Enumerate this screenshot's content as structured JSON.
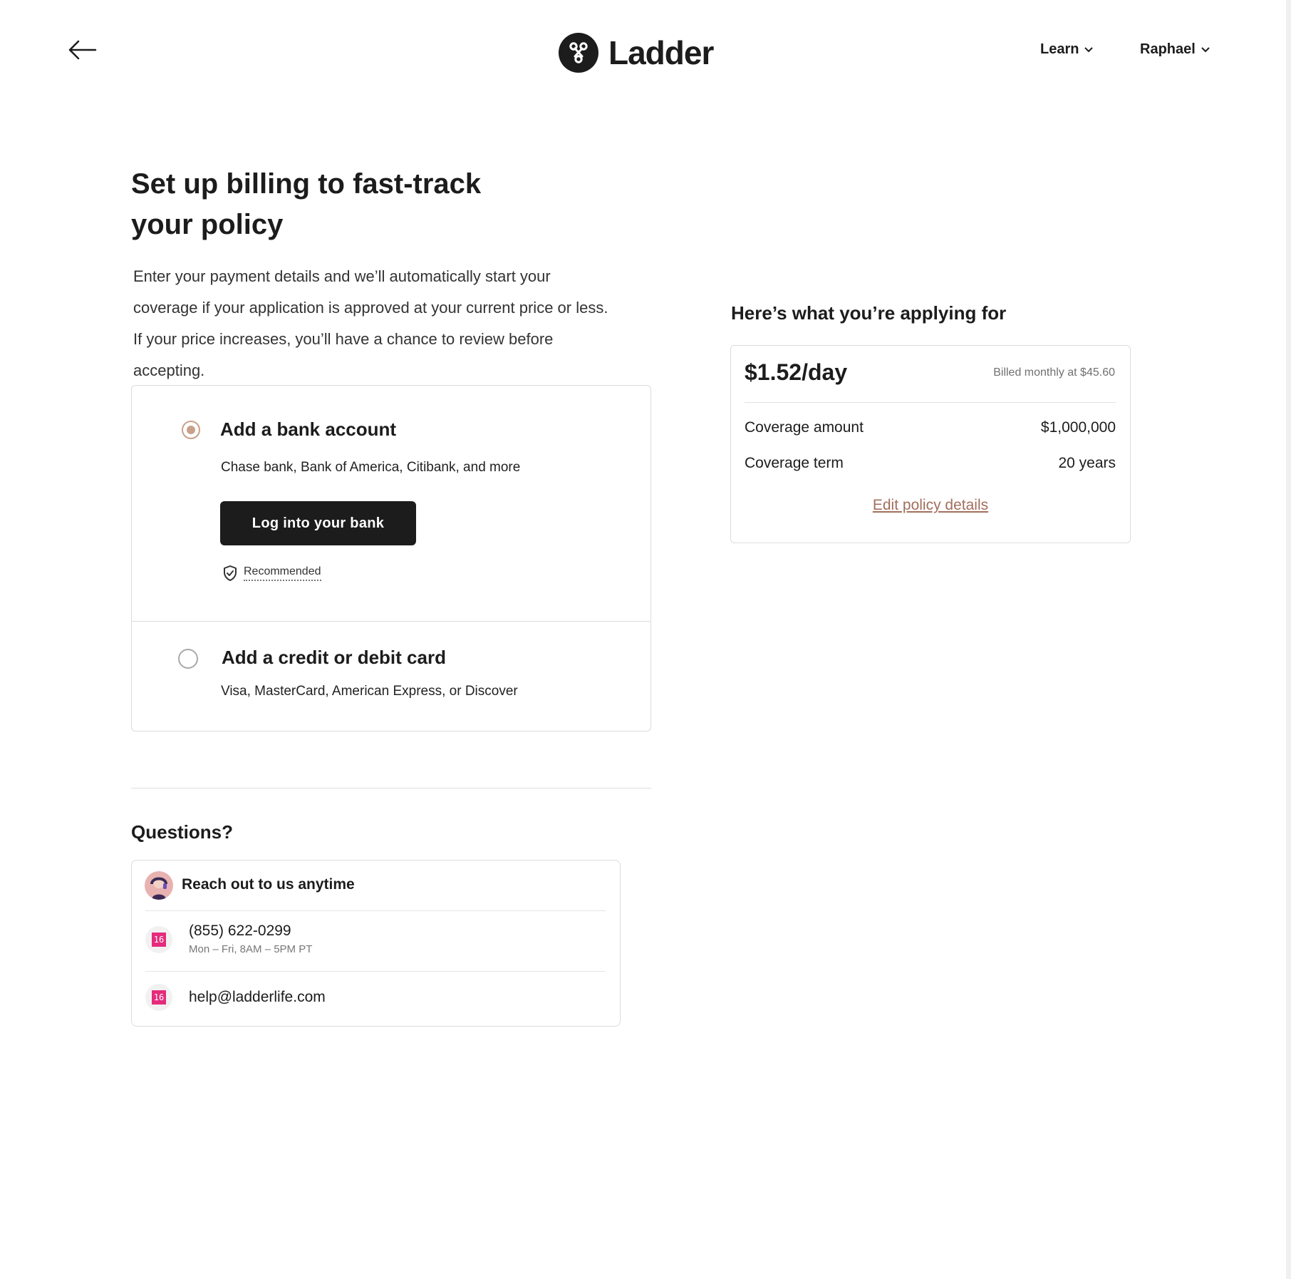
{
  "header": {
    "brand": "Ladder",
    "nav": [
      {
        "label": "Learn"
      },
      {
        "label": "Raphael"
      }
    ]
  },
  "main": {
    "title_line1": "Set up billing to fast-track",
    "title_line2": "your policy",
    "intro": "Enter your payment details and we’ll automatically start your coverage if your application is approved at your current price or less. If your price increases, you’ll have a chance to review before accepting.",
    "options": [
      {
        "title": "Add a bank account",
        "subtitle": "Chase bank, Bank of America, Citibank, and more",
        "button": "Log into your bank",
        "badge": "Recommended",
        "selected": true
      },
      {
        "title": "Add a credit or debit card",
        "subtitle": "Visa, MasterCard, American Express, or Discover",
        "selected": false
      }
    ]
  },
  "questions": {
    "heading": "Questions?",
    "reach_out": "Reach out to us anytime",
    "phone": "(855) 622-0299",
    "hours": "Mon – Fri, 8AM – 5PM PT",
    "email": "help@ladderlife.com",
    "icon_text": "16"
  },
  "summary": {
    "heading": "Here’s what you’re applying for",
    "price": "$1.52/day",
    "billed": "Billed monthly at $45.60",
    "rows": [
      {
        "label": "Coverage amount",
        "value": "$1,000,000"
      },
      {
        "label": "Coverage term",
        "value": "20 years"
      }
    ],
    "edit_link": "Edit policy details"
  },
  "colors": {
    "accent": "#c9a18a",
    "link": "#a26f5d",
    "dark": "#1c1c1c",
    "icon_pink": "#e52b7b"
  }
}
